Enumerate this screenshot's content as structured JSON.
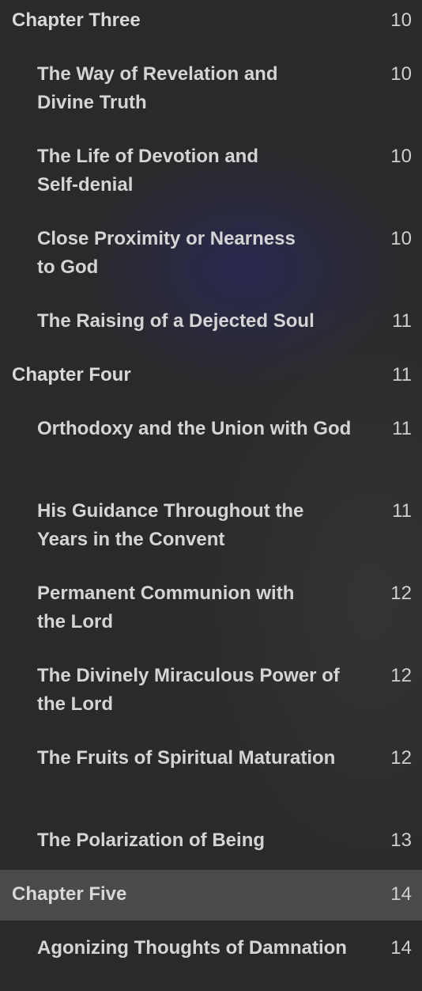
{
  "toc": {
    "chapter3": {
      "title": "Chapter Three",
      "page": "10"
    },
    "ch3_items": [
      {
        "title": "The Way of Revelation and\nDivine Truth",
        "page": "10"
      },
      {
        "title": "The Life of Devotion and\nSelf-denial",
        "page": "10"
      },
      {
        "title": "Close Proximity or Nearness\nto God",
        "page": "10"
      },
      {
        "title": "The Raising of a Dejected Soul",
        "page": "11"
      }
    ],
    "chapter4": {
      "title": "Chapter Four",
      "page": "11"
    },
    "ch4_items": [
      {
        "title": "Orthodoxy and the Union with God",
        "page": "11"
      },
      {
        "title": "His Guidance Throughout the\nYears in the Convent",
        "page": "11"
      },
      {
        "title": "Permanent Communion with\nthe Lord",
        "page": "12"
      },
      {
        "title": "The Divinely Miraculous Power of\nthe Lord",
        "page": "12"
      },
      {
        "title": "The Fruits of Spiritual Maturation",
        "page": "12"
      },
      {
        "title": "The Polarization of Being",
        "page": "13"
      }
    ],
    "chapter5": {
      "title": "Chapter Five",
      "page": "14"
    },
    "ch5_items": [
      {
        "title": "Agonizing Thoughts of Damnation",
        "page": "14"
      }
    ]
  }
}
